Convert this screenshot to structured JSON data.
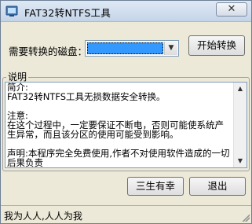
{
  "window": {
    "title": "FAT32转NTFS工具",
    "close_label": "✕"
  },
  "form": {
    "drive_label": "需要转换的磁盘：",
    "drive_selected": "",
    "start_button": "开始转换"
  },
  "description": {
    "group_label": "说明",
    "text": "简介:\nFAT32转NTFS工具无损数据安全转换。\n\n注意:\n在这个过程中，一定要保证不断电，否则可能使系统产生异常，而且该分区的使用可能受到影响。\n\n声明:本程序完全免费使用,作者不对使用软件造成的一切后果负责"
  },
  "buttons": {
    "sanshengyouxing": "三生有幸",
    "exit": "退出"
  },
  "status": {
    "text": "我为人人,人人为我"
  },
  "colors": {
    "accent": "#3399ff",
    "face": "#ece9d8"
  },
  "icons": {
    "app": "app-icon",
    "close": "close-icon",
    "dropdown": "chevron-down-icon"
  }
}
